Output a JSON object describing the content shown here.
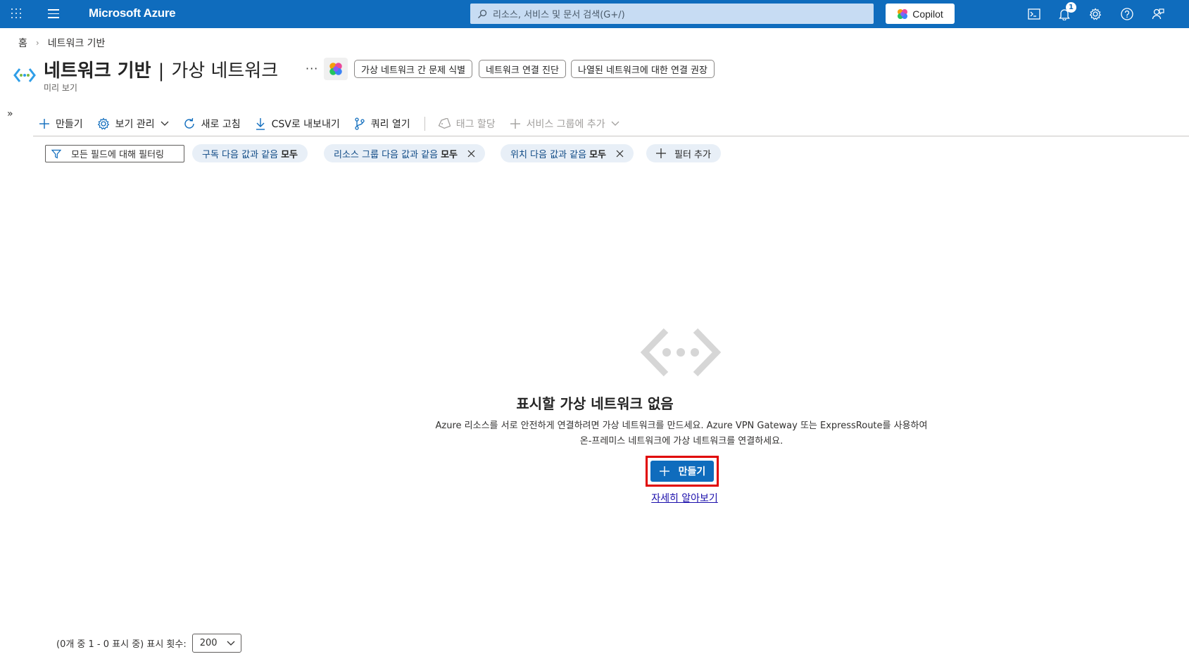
{
  "topbar": {
    "brand": "Microsoft Azure",
    "search_placeholder": "리소스, 서비스 및 문서 검색(G+/)",
    "copilot_label": "Copilot",
    "notification_count": "1",
    "color": "#0f6cbd"
  },
  "breadcrumb": {
    "home": "홈",
    "current": "네트워크 기반"
  },
  "header": {
    "title_bold": "네트워크 기반",
    "title_separator": "|",
    "title_rest": "가상 네트워크",
    "subtitle": "미리 보기",
    "more": "···",
    "buttons": [
      "가상 네트워크 간 문제 식별",
      "네트워크 연결 진단",
      "나열된 네트워크에 대한 연결 권장"
    ]
  },
  "commandbar": {
    "create": "만들기",
    "manage_view": "보기 관리",
    "refresh": "새로 고침",
    "export_csv": "CSV로 내보내기",
    "open_query": "쿼리 열기",
    "assign_tags": "태그 할당",
    "add_to_service_group": "서비스 그룹에 추가"
  },
  "filters": {
    "placeholder": "모든 필드에 대해 필터링",
    "chips": [
      {
        "key": "구독 다음 값과 같음",
        "value": "모두"
      },
      {
        "key": "리소스 그룹 다음 값과 같음",
        "value": "모두"
      },
      {
        "key": "위치 다음 값과 같음",
        "value": "모두"
      }
    ],
    "add_filter": "필터 추가"
  },
  "empty_state": {
    "title": "표시할 가상 네트워크 없음",
    "description_line1": "Azure 리소스를 서로 안전하게 연결하려면 가상 네트워크를 만드세요. Azure VPN Gateway 또는 ExpressRoute를 사용하여",
    "description_line2": "온-프레미스 네트워크에 가상 네트워크를 연결하세요.",
    "create_button": "만들기",
    "learn_more": "자세히 알아보기"
  },
  "footer": {
    "summary": "(0개 중 1 - 0 표시 중) 표시 횟수:",
    "page_size": "200"
  }
}
